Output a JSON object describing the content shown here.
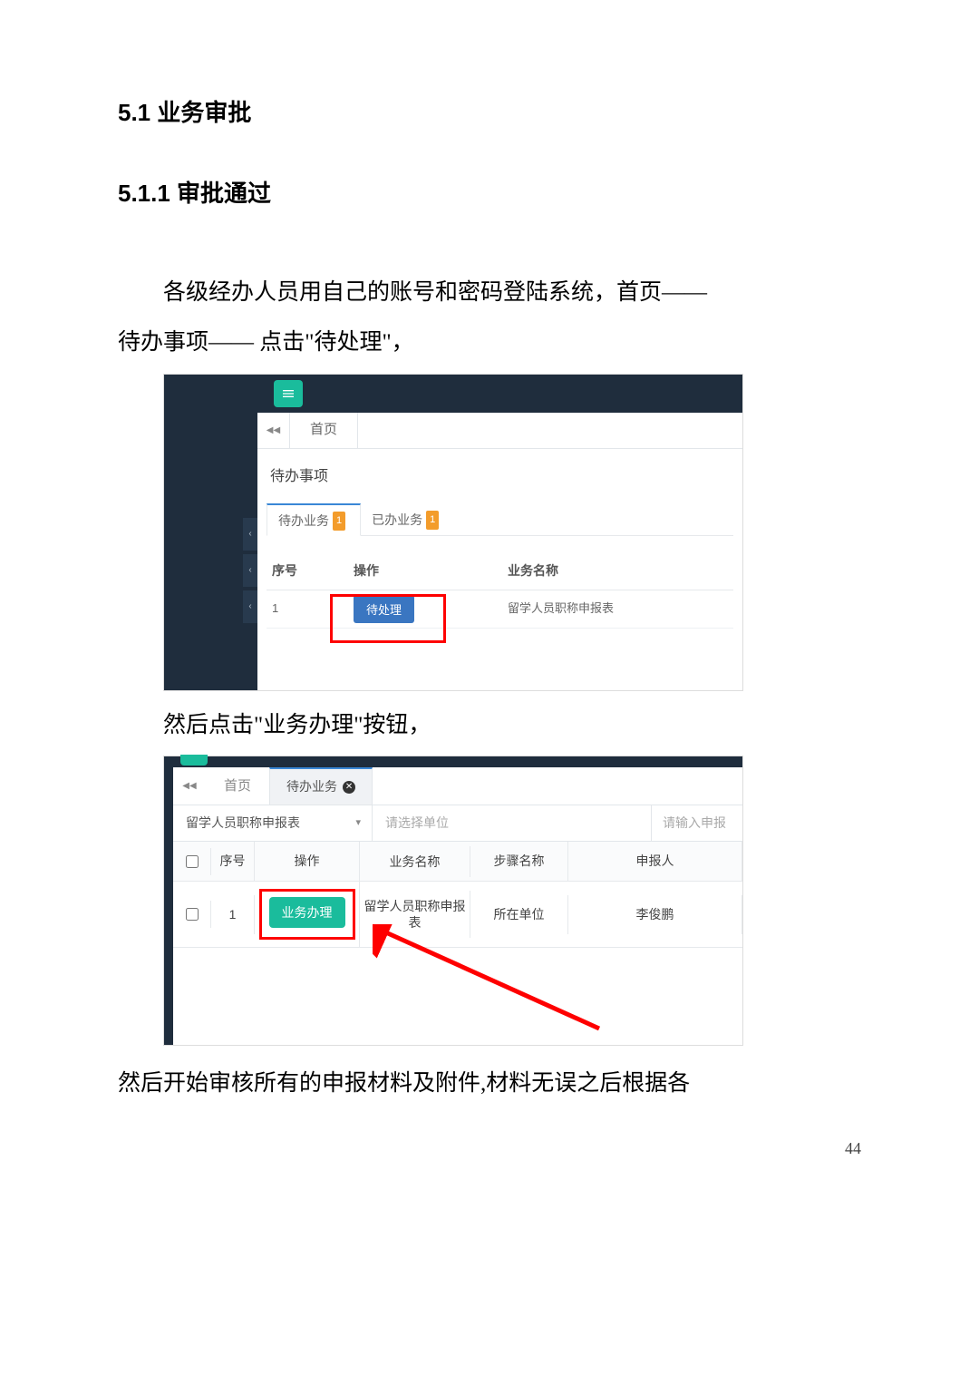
{
  "headings": {
    "h51": "5.1 业务审批",
    "h511": "5.1.1 审批通过"
  },
  "para": {
    "p1a": "各级经办人员用自己的账号和密码登陆系统，首页——",
    "p1b": "待办事项—— 点击\"待处理\"，",
    "p2": "然后点击\"业务办理\"按钮，",
    "p3": "然后开始审核所有的申报材料及附件,材料无误之后根据各"
  },
  "shot1": {
    "tab_home": "首页",
    "panel_title": "待办事项",
    "subtabs": {
      "pending": {
        "label": "待办业务",
        "count": "1"
      },
      "done": {
        "label": "已办业务",
        "count": "1"
      }
    },
    "headers": {
      "seq": "序号",
      "op": "操作",
      "biz": "业务名称"
    },
    "row": {
      "seq": "1",
      "btn": "待处理",
      "biz": "留学人员职称申报表"
    }
  },
  "shot2": {
    "tab_home": "首页",
    "tab_active": "待办业务",
    "filters": {
      "select": "留学人员职称申报表",
      "unit_placeholder": "请选择单位",
      "report_placeholder": "请输入申报"
    },
    "headers": {
      "seq": "序号",
      "op": "操作",
      "biz": "业务名称",
      "step": "步骤名称",
      "person": "申报人"
    },
    "row": {
      "seq": "1",
      "btn": "业务办理",
      "biz": "留学人员职称申报表",
      "step": "所在单位",
      "person": "李俊鹏"
    }
  },
  "pagenum": "44"
}
